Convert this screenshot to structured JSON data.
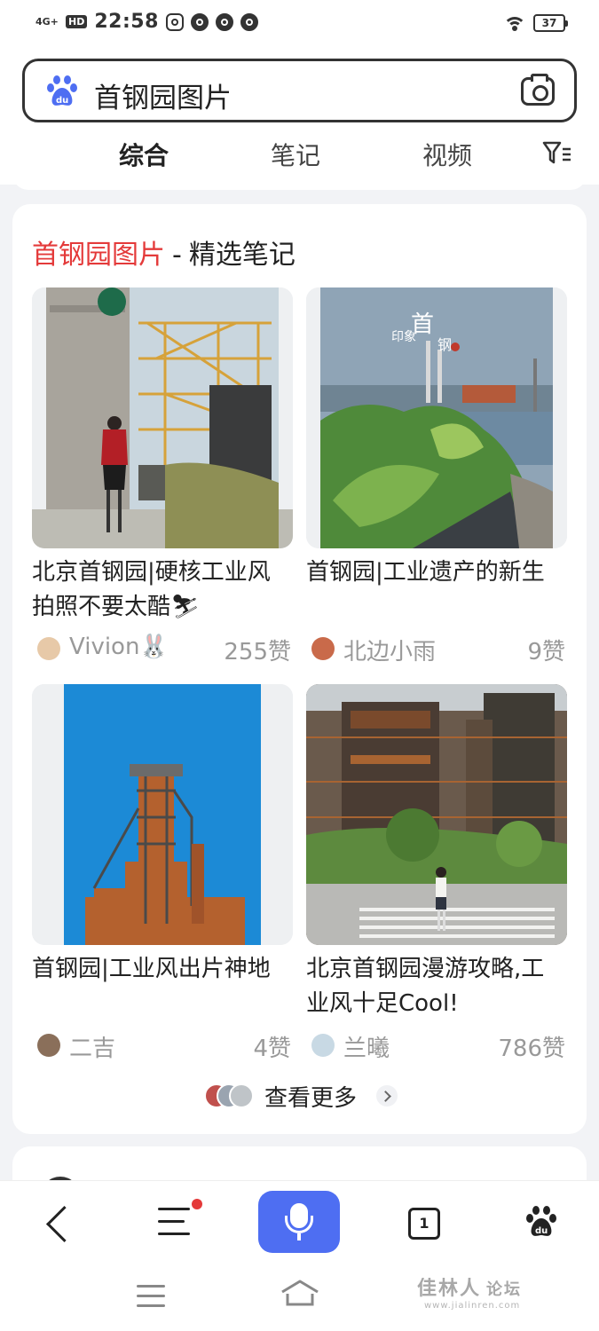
{
  "status_bar": {
    "network": "4G+",
    "hd": "HD",
    "time": "22:58",
    "battery": "37",
    "icons": [
      "app-icon",
      "search-icon",
      "search-icon",
      "compass-icon"
    ]
  },
  "search": {
    "query": "首钢园图片",
    "logo": "baidu-paw-icon",
    "camera": "camera-icon"
  },
  "tabs": [
    {
      "label": "综合",
      "active": true
    },
    {
      "label": "笔记",
      "active": false
    },
    {
      "label": "视频",
      "active": false
    }
  ],
  "card": {
    "title_highlight": "首钢园图片",
    "title_sep": "-",
    "title_rest": "精选笔记",
    "notes": [
      {
        "title": "北京首钢园|硬核工业风拍照不要太酷⛷",
        "author": "Vivion🐰",
        "likes": "255赞"
      },
      {
        "title": "首钢园|工业遗产的新生",
        "author": "北边小雨",
        "likes": "9赞"
      },
      {
        "title": "首钢园|工业风出片神地",
        "author": "二吉",
        "likes": "4赞"
      },
      {
        "title": "北京首钢园漫游攻略,工业风十足Cool!",
        "author": "兰曦",
        "likes": "786赞"
      }
    ],
    "more_label": "查看更多"
  },
  "toolbar": {
    "tab_count": "1"
  },
  "watermark": {
    "main": "佳林人",
    "suffix": "论坛",
    "sub": "www.jialinren.com"
  },
  "colors": {
    "accent": "#4e6ef2",
    "highlight": "#e43a3a"
  }
}
